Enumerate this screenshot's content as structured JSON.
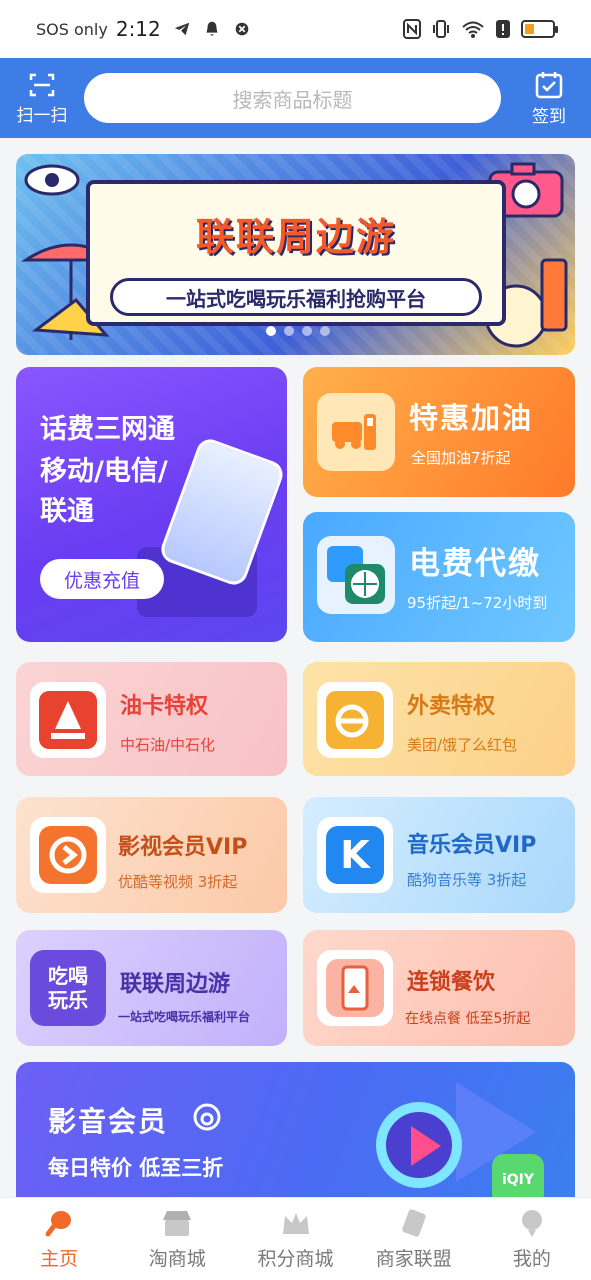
{
  "status_bar": {
    "carrier": "SOS only",
    "time": "2:12"
  },
  "header": {
    "scan_label": "扫一扫",
    "search_placeholder": "搜索商品标题",
    "checkin_label": "签到",
    "bg_color": "#3f7de6"
  },
  "banner": {
    "title": "联联周边游",
    "subtitle": "一站式吃喝玩乐福利抢购平台",
    "page_count": 4,
    "active_index": 0
  },
  "tiles": {
    "phone_recharge": {
      "line1": "话费三网通",
      "line2": "移动/电信/",
      "line3": "联通",
      "button": "优惠充值"
    },
    "fuel": {
      "title": "特惠加油",
      "subtitle": "全国加油7折起"
    },
    "electricity": {
      "title": "电费代缴",
      "subtitle": "95折起/1~72小时到"
    },
    "oil_card": {
      "title": "油卡特权",
      "subtitle": "中石油/中石化"
    },
    "takeout": {
      "title": "外卖特权",
      "subtitle": "美团/饿了么红包"
    },
    "video_vip": {
      "title": "影视会员VIP",
      "subtitle": "优酷等视频 3折起"
    },
    "music_vip": {
      "title": "音乐会员VIP",
      "subtitle": "酷狗音乐等 3折起"
    },
    "local_tour": {
      "title": "联联周边游",
      "subtitle": "一站式吃喝玩乐福利平台",
      "icon_text_1": "吃喝",
      "icon_text_2": "玩乐"
    },
    "chain_dining": {
      "title": "连锁餐饮",
      "subtitle": "在线点餐  低至5折起"
    },
    "av_member": {
      "title": "影音会员",
      "subtitle": "每日特价  低至三折"
    }
  },
  "tabbar": {
    "items": [
      {
        "label": "主页",
        "icon": "drumstick-icon",
        "active": true
      },
      {
        "label": "淘商城",
        "icon": "store-icon",
        "active": false
      },
      {
        "label": "积分商城",
        "icon": "crown-icon",
        "active": false
      },
      {
        "label": "商家联盟",
        "icon": "ticket-icon",
        "active": false
      },
      {
        "label": "我的",
        "icon": "profile-icon",
        "active": false
      }
    ],
    "active_color": "#f16a2b",
    "inactive_color": "#7a7a7a"
  }
}
